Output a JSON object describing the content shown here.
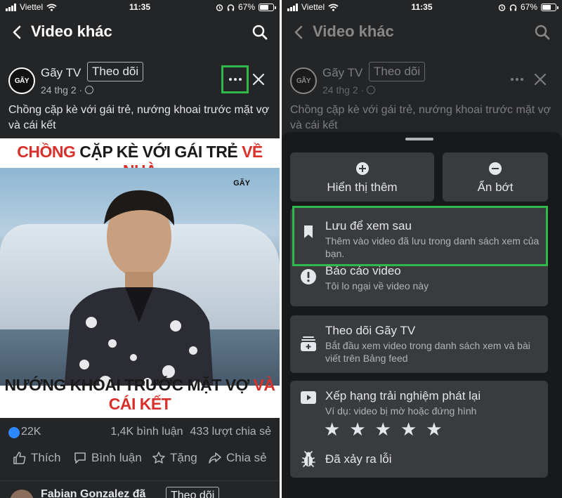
{
  "status": {
    "carrier": "Viettel",
    "time": "11:35",
    "battery": "67%"
  },
  "header": {
    "title": "Video khác"
  },
  "post": {
    "avatar_text": "GÃY",
    "channel": "Gãy TV",
    "follow": "Theo dõi",
    "date": "24 thg 2 ·",
    "caption": "Chồng cặp kè với gái trẻ, nướng khoai trước mặt vợ và cái kết"
  },
  "video": {
    "top_red1": "CHỒNG",
    "top_dark": "CẶP KÈ VỚI GÁI TRẺ",
    "top_red2": "VỀ NHÀ",
    "bottom_dark": "NƯỚNG KHOAI TRƯỚC MẶT VỢ",
    "bottom_red": "VÀ CÁI KẾT",
    "logo": "GÃY"
  },
  "stats": {
    "likes": "22K",
    "comments": "1,4K bình luận",
    "shares": "433 lượt chia sẻ"
  },
  "actions": {
    "like": "Thích",
    "comment": "Bình luận",
    "gift": "Tặng",
    "share": "Chia sẻ"
  },
  "next_post": {
    "name": "Fabian Gonzalez đã",
    "follow": "Theo dõi"
  },
  "sheet": {
    "show_more": "Hiển thị thêm",
    "show_less": "Ẩn bớt",
    "save_title": "Lưu để xem sau",
    "save_sub": "Thêm vào video đã lưu trong danh sách xem của bạn.",
    "report_title": "Báo cáo video",
    "report_sub": "Tôi lo ngại về video này",
    "follow_title": "Theo dõi Gãy TV",
    "follow_sub": "Bắt đầu xem video trong danh sách xem và bài viết trên Bảng feed",
    "rate_title": "Xếp hạng trải nghiệm phát lại",
    "rate_sub": "Ví dụ: video bị mờ hoặc đứng hình",
    "stars": [
      "★",
      "★",
      "★",
      "★",
      "★"
    ],
    "bug": "Đã xảy ra lỗi"
  },
  "colors": {
    "highlight": "#31b84a",
    "like_blue": "#2d88ff",
    "title_red": "#d9302b",
    "bg": "#242526"
  }
}
